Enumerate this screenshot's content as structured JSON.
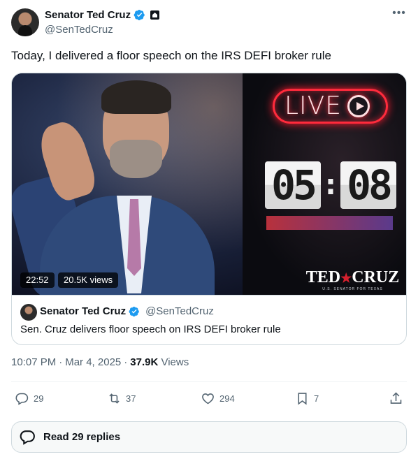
{
  "author": {
    "display_name": "Senator Ted Cruz",
    "handle": "@SenTedCruz",
    "verified_icon": "verified-badge-icon",
    "gov_icon": "government-badge-icon"
  },
  "tweet": {
    "text": "Today, I delivered a floor speech on the IRS DEFI broker rule"
  },
  "media": {
    "live_label": "LIVE",
    "clock_minutes": "05",
    "clock_seconds": "08",
    "brand_name": "TED",
    "brand_name_2": "CRUZ",
    "brand_tagline": "U.S. SENATOR FOR TEXAS",
    "duration": "22:52",
    "views": "20.5K views"
  },
  "card": {
    "author_name": "Senator Ted Cruz",
    "author_handle": "@SenTedCruz",
    "title": "Sen. Cruz delivers floor speech on IRS DEFI broker rule"
  },
  "meta": {
    "time": "10:07 PM",
    "date": "Mar 4, 2025",
    "views_count": "37.9K",
    "views_label": "Views",
    "separator": "·"
  },
  "actions": {
    "replies": "29",
    "reposts": "37",
    "likes": "294",
    "bookmarks": "7"
  },
  "read_replies_label": "Read 29 replies",
  "colors": {
    "text_primary": "#0f1419",
    "text_secondary": "#536471",
    "verified_blue": "#1d9bf0",
    "border": "#cfd9de"
  }
}
